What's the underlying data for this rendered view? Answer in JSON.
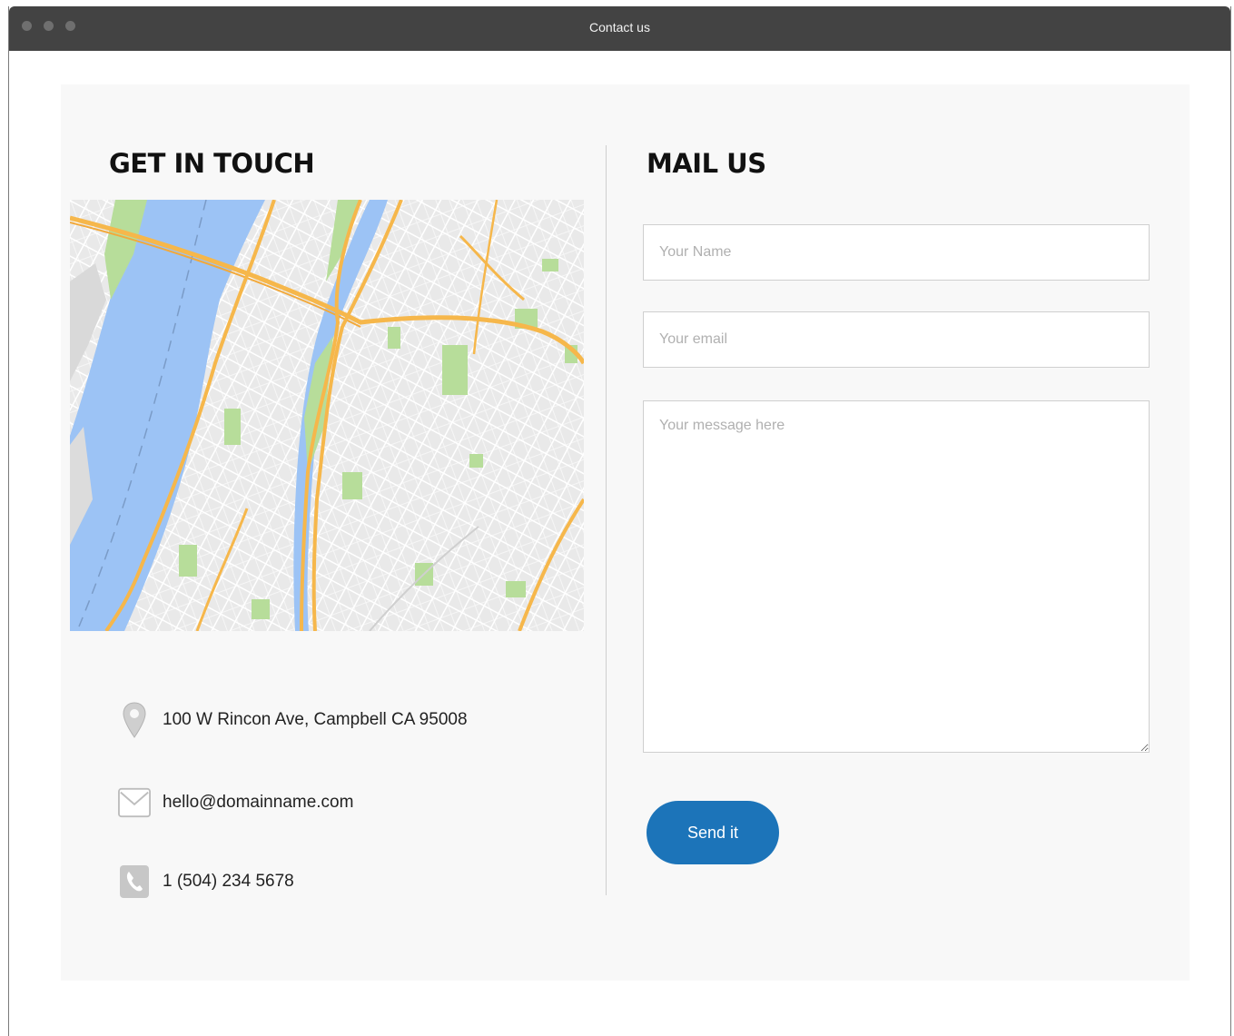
{
  "window": {
    "title": "Contact us"
  },
  "left": {
    "heading": "GET IN TOUCH",
    "contact": {
      "address": "100 W Rincon Ave, Campbell CA 95008",
      "email": "hello@domainname.com",
      "phone": "1 (504) 234 5678"
    },
    "icons": [
      "map-pin-icon",
      "envelope-icon",
      "phone-icon"
    ]
  },
  "right": {
    "heading": "MAIL US",
    "form": {
      "name_placeholder": "Your Name",
      "email_placeholder": "Your email",
      "message_placeholder": "Your message here",
      "submit_label": "Send it"
    }
  },
  "colors": {
    "accent": "#1c74b9",
    "panel": "#f8f8f8",
    "titlebar": "#434343",
    "map_water": "#9cc3f5",
    "map_road": "#f6b74b",
    "map_park": "#b7dd9a"
  }
}
